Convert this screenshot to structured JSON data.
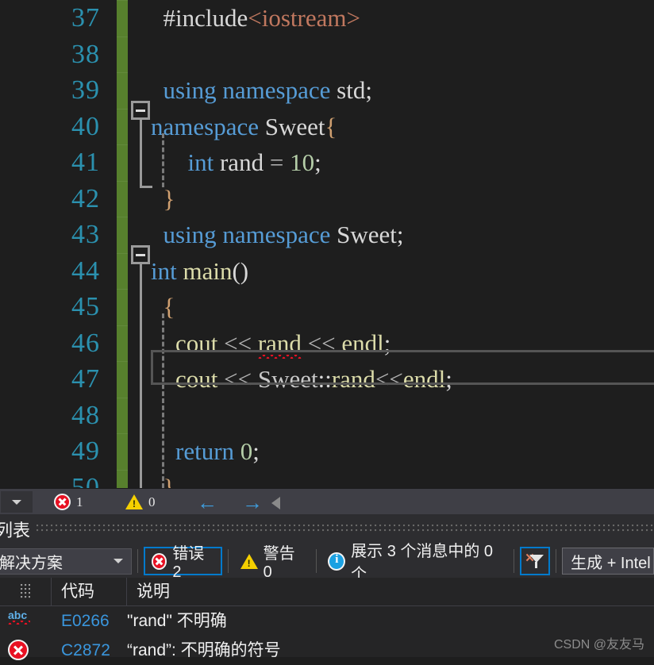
{
  "editor": {
    "first_visible_line": 37,
    "current_line": 47,
    "lines": [
      {
        "n": "37",
        "tokens": [
          {
            "t": "#include",
            "c": "t-plain"
          },
          {
            "t": "<iostream>",
            "c": "t-str"
          }
        ],
        "indent": 0
      },
      {
        "n": "38",
        "tokens": [],
        "indent": 0
      },
      {
        "n": "39",
        "tokens": [
          {
            "t": "using namespace ",
            "c": "t-kw"
          },
          {
            "t": "std;",
            "c": "t-plain"
          }
        ],
        "indent": 0
      },
      {
        "n": "40",
        "tokens": [
          {
            "t": "namespace ",
            "c": "t-kw"
          },
          {
            "t": "Sweet",
            "c": "t-plain"
          },
          {
            "t": "{",
            "c": "t-brace"
          }
        ],
        "indent": 0
      },
      {
        "n": "41",
        "tokens": [
          {
            "t": "int",
            "c": "t-kw"
          },
          {
            "t": " rand ",
            "c": "t-plain"
          },
          {
            "t": "= ",
            "c": "t-op"
          },
          {
            "t": "10",
            "c": "t-num"
          },
          {
            "t": ";",
            "c": "t-plain"
          }
        ],
        "indent": 0
      },
      {
        "n": "42",
        "tokens": [
          {
            "t": "}",
            "c": "t-brace"
          }
        ],
        "indent": 0
      },
      {
        "n": "43",
        "tokens": [
          {
            "t": "using namespace ",
            "c": "t-kw"
          },
          {
            "t": "Sweet;",
            "c": "t-plain"
          }
        ],
        "indent": 0
      },
      {
        "n": "44",
        "tokens": [
          {
            "t": "int ",
            "c": "t-kw"
          },
          {
            "t": "main",
            "c": "t-fn"
          },
          {
            "t": "()",
            "c": "t-plain"
          }
        ],
        "indent": 0
      },
      {
        "n": "45",
        "tokens": [
          {
            "t": "{",
            "c": "t-brace"
          }
        ],
        "indent": 0
      },
      {
        "n": "46",
        "tokens": [
          {
            "t": "cout ",
            "c": "t-fn"
          },
          {
            "t": "<< ",
            "c": "t-op"
          },
          {
            "t": "rand",
            "c": "t-fn",
            "squiggle": true
          },
          {
            "t": " ",
            "c": "t-plain"
          },
          {
            "t": "<< ",
            "c": "t-op"
          },
          {
            "t": "endl",
            "c": "t-fn"
          },
          {
            "t": ";",
            "c": "t-plain"
          }
        ],
        "indent": 0
      },
      {
        "n": "47",
        "tokens": [
          {
            "t": "cout ",
            "c": "t-fn"
          },
          {
            "t": "<< ",
            "c": "t-op"
          },
          {
            "t": "Sweet",
            "c": "t-type"
          },
          {
            "t": "::",
            "c": "t-plain"
          },
          {
            "t": "rand",
            "c": "t-fn"
          },
          {
            "t": "<<",
            "c": "t-op"
          },
          {
            "t": "endl",
            "c": "t-fn"
          },
          {
            "t": ";",
            "c": "t-plain"
          }
        ],
        "indent": 0
      },
      {
        "n": "48",
        "tokens": [],
        "indent": 0
      },
      {
        "n": "49",
        "tokens": [
          {
            "t": "return ",
            "c": "t-kw"
          },
          {
            "t": "0",
            "c": "t-num"
          },
          {
            "t": ";",
            "c": "t-plain"
          }
        ],
        "indent": 0
      },
      {
        "n": "50",
        "tokens": [
          {
            "t": "}",
            "c": "t-brace"
          }
        ],
        "indent": 0
      }
    ],
    "line_number_color": "#2b91af",
    "change_bar_color": "#57802d",
    "background_color": "#1e1e1e"
  },
  "statusbar": {
    "error_count": "1",
    "warning_count": "0",
    "prev_arrow": "←",
    "next_arrow": "→"
  },
  "error_panel": {
    "title": "列表",
    "scope_filter": "解决方案",
    "errors_label": "错误 2",
    "warnings_label": "警告 0",
    "messages_label": "展示 3 个消息中的 0 个",
    "build_filter": "生成 + Intel",
    "selection_accent": "#007acc",
    "columns": [
      "代码",
      "说明"
    ],
    "rows": [
      {
        "icon": "intellisense-squiggle-icon",
        "code": "E0266",
        "description": "\"rand\" 不明确"
      },
      {
        "icon": "error-icon",
        "code": "C2872",
        "description": "“rand”: 不明确的符号"
      }
    ]
  },
  "watermark": "CSDN @友友马"
}
